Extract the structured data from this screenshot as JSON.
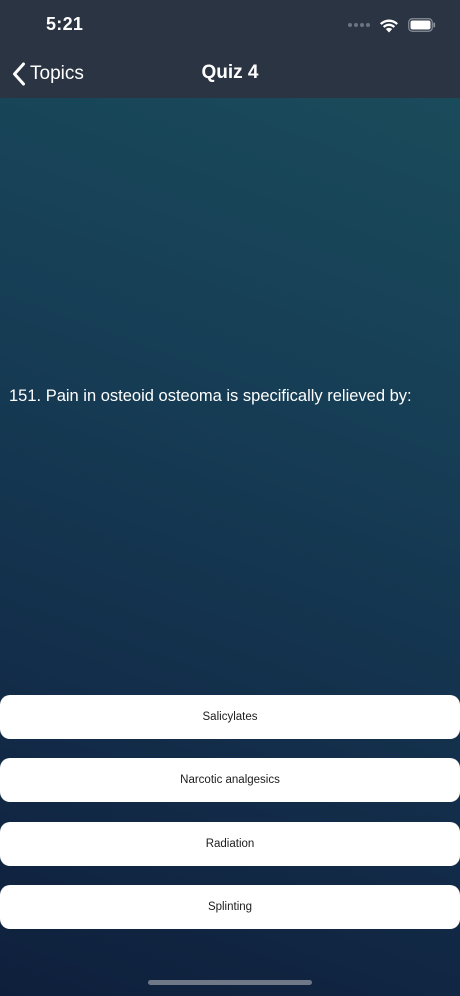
{
  "status_bar": {
    "time": "5:21",
    "icons": [
      "signal-dots-icon",
      "wifi-icon",
      "battery-icon"
    ]
  },
  "nav": {
    "back_label": "Topics",
    "title": "Quiz 4"
  },
  "quiz": {
    "question": "151. Pain in osteoid osteoma is specifically relieved by:",
    "answers": [
      {
        "label": "Salicylates"
      },
      {
        "label": "Narcotic analgesics"
      },
      {
        "label": "Radiation"
      },
      {
        "label": "Splinting"
      }
    ]
  },
  "colors": {
    "nav_background": "#2b3442",
    "gradient_top": "#1a4b5b",
    "gradient_bottom": "#0e1f3b",
    "answer_background": "#ffffff",
    "answer_text": "#1c1c1e"
  }
}
